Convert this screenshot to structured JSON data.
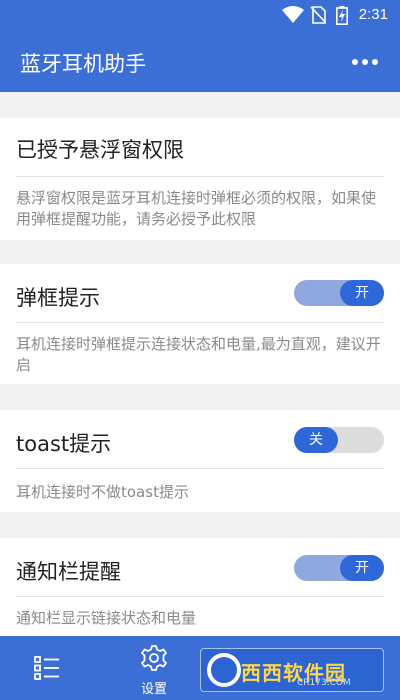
{
  "status_bar": {
    "time": "2:31",
    "icons": [
      "wifi-icon",
      "no-sim-icon",
      "battery-charging-icon"
    ]
  },
  "app_bar": {
    "title": "蓝牙耳机助手",
    "menu_icon": "more-horizontal-icon"
  },
  "cards": [
    {
      "title": "已授予悬浮窗权限",
      "description": "悬浮窗权限是蓝牙耳机连接时弹框必须的权限，如果使用弹框提醒功能，请务必授予此权限"
    },
    {
      "title": "弹框提示",
      "toggle": "开",
      "toggle_on": true,
      "description": "耳机连接时弹框提示连接状态和电量,最为直观，建议开启"
    },
    {
      "title": "toast提示",
      "toggle": "关",
      "toggle_on": false,
      "description": "耳机连接时不做toast提示"
    },
    {
      "title": "通知栏提醒",
      "toggle": "开",
      "toggle_on": true,
      "description": "通知栏显示链接状态和电量"
    }
  ],
  "bottom_nav": {
    "items": [
      {
        "label": "",
        "icon": "list-icon"
      },
      {
        "label": "设置",
        "icon": "settings-gear-icon"
      }
    ]
  },
  "watermark": {
    "text": "西西软件园",
    "sub": "CR173.COM"
  },
  "colors": {
    "primary": "#3c6fd6",
    "toggle_knob": "#2f66d8",
    "toggle_track_on": "#8fa9de",
    "toggle_track_off": "#dcdcdc"
  }
}
